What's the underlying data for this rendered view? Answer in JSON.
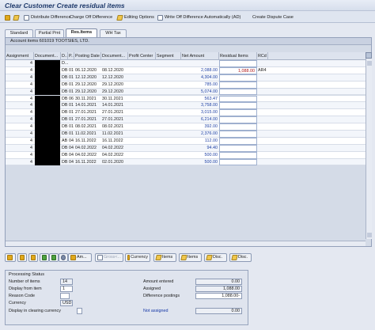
{
  "window": {
    "title": "Clear Customer Create residual items"
  },
  "toolbar": {
    "distribute": "Distribute Difference",
    "charge_off": "Charge Off Difference",
    "editing_options": "Editing Options",
    "write_off": "Write Off Difference Automatically (AD)",
    "dispute": "Create Dispute Case"
  },
  "tabs": [
    "Standard",
    "Partial Pmt",
    "Res.Items",
    "WH Tax"
  ],
  "active_tab": "Res.Items",
  "account_items": {
    "title": "Account items 601019 TOOTSIES, LTD."
  },
  "columns": [
    "Assignment",
    "Document...",
    "D...",
    "P...",
    "Posting Date",
    "Document...",
    "Profit Center",
    "Segment",
    "Net Amount",
    "Residual Items",
    "RCd"
  ],
  "rows": [
    {
      "a": "4",
      "d": "D...",
      "p": "",
      "pd": "",
      "dd": "",
      "amt": "",
      "res": "",
      "rcd": ""
    },
    {
      "a": "4",
      "d": "DB",
      "p": "01",
      "pd": "06.12.2020",
      "dd": "08.12.2020",
      "amt": "2,088.00",
      "res": "1,088.00",
      "rcd": "AR4"
    },
    {
      "a": "4",
      "d": "DB",
      "p": "01",
      "pd": "12.12.2020",
      "dd": "12.12.2020",
      "amt": "4,304.00",
      "res": "",
      "rcd": ""
    },
    {
      "a": "4",
      "d": "DB",
      "p": "01",
      "pd": "29.12.2020",
      "dd": "29.12.2020",
      "amt": "785.00",
      "res": "",
      "rcd": ""
    },
    {
      "a": "4",
      "d": "DB",
      "p": "01",
      "pd": "29.12.2020",
      "dd": "29.12.2020",
      "amt": "5,074.00",
      "res": "",
      "rcd": ""
    },
    {
      "a": "4",
      "d": "DB",
      "p": "06",
      "pd": "30.11.2021",
      "dd": "30.11.2021",
      "amt": "563.47",
      "res": "",
      "rcd": ""
    },
    {
      "a": "4",
      "d": "DB",
      "p": "01",
      "pd": "14.01.2021",
      "dd": "14.01.2021",
      "amt": "3,758.00",
      "res": "",
      "rcd": ""
    },
    {
      "a": "4",
      "d": "DB",
      "p": "01",
      "pd": "27.01.2021",
      "dd": "27.01.2021",
      "amt": "3,015.00",
      "res": "",
      "rcd": ""
    },
    {
      "a": "4",
      "d": "DB",
      "p": "01",
      "pd": "27.01.2021",
      "dd": "27.01.2021",
      "amt": "6,214.00",
      "res": "",
      "rcd": ""
    },
    {
      "a": "4",
      "d": "DB",
      "p": "01",
      "pd": "08.02.2021",
      "dd": "08.02.2021",
      "amt": "392.00",
      "res": "",
      "rcd": ""
    },
    {
      "a": "4",
      "d": "DB",
      "p": "01",
      "pd": "11.02.2021",
      "dd": "11.02.2021",
      "amt": "2,376.00",
      "res": "",
      "rcd": ""
    },
    {
      "a": "4",
      "d": "AB",
      "p": "04",
      "pd": "16.11.2022",
      "dd": "16.11.2022",
      "amt": "112.00",
      "res": "",
      "rcd": ""
    },
    {
      "a": "4",
      "d": "DB",
      "p": "04",
      "pd": "04.02.2022",
      "dd": "04.02.2022",
      "amt": "94.40",
      "res": "",
      "rcd": ""
    },
    {
      "a": "4",
      "d": "DB",
      "p": "04",
      "pd": "04.02.2022",
      "dd": "04.02.2022",
      "amt": "500.00",
      "res": "",
      "rcd": ""
    },
    {
      "a": "4",
      "d": "DB",
      "p": "04",
      "pd": "16.11.2022",
      "dd": "02.01.2020",
      "amt": "500.00",
      "res": "",
      "rcd": ""
    }
  ],
  "buttons": {
    "am": "Am...",
    "gross": "Gross<...",
    "currency": "Currency",
    "items1": "Items",
    "items2": "Items",
    "disc1": "Disc.",
    "disc2": "Disc."
  },
  "processing": {
    "title": "Processing Status",
    "number_of_items_label": "Number of items",
    "number_of_items": "14",
    "display_from_label": "Display from item",
    "display_from": "1",
    "reason_code_label": "Reason Code",
    "reason_code": "",
    "currency_label": "Currency",
    "currency": "USD",
    "display_clearing_label": "Display in clearing currency",
    "amount_entered_label": "Amount entered",
    "amount_entered": "0.00",
    "assigned_label": "Assigned",
    "assigned": "1,088.00",
    "diff_postings_label": "Difference postings",
    "diff_postings": "1,088.00-",
    "not_assigned_label": "Not assigned",
    "not_assigned": "0.00"
  }
}
